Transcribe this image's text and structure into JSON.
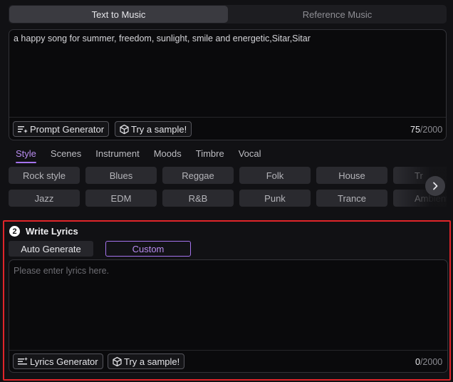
{
  "top_tabs": [
    {
      "label": "Text to Music",
      "active": true
    },
    {
      "label": "Reference Music",
      "active": false
    }
  ],
  "prompt": {
    "text": "a happy song for summer, freedom, sunlight, smile and energetic,Sitar,Sitar",
    "generator_label": "Prompt Generator",
    "sample_label": "Try a sample!",
    "count": "75",
    "max": "/2000"
  },
  "category_tabs": [
    "Style",
    "Scenes",
    "Instrument",
    "Moods",
    "Timbre",
    "Vocal"
  ],
  "genres_row1": [
    "Rock style",
    "Blues",
    "Reggae",
    "Folk",
    "House",
    "Tr"
  ],
  "genres_row2": [
    "Jazz",
    "EDM",
    "R&B",
    "Punk",
    "Trance",
    "Ambient"
  ],
  "lyrics": {
    "step": "2",
    "title": "Write Lyrics",
    "auto_label": "Auto Generate",
    "custom_label": "Custom",
    "placeholder": "Please enter lyrics here.",
    "generator_label": "Lyrics Generator",
    "sample_label": "Try a sample!",
    "count": "0",
    "max": "/2000"
  },
  "colors": {
    "accent": "#a573ee",
    "highlight_border": "#e0252a",
    "background": "#111114"
  }
}
